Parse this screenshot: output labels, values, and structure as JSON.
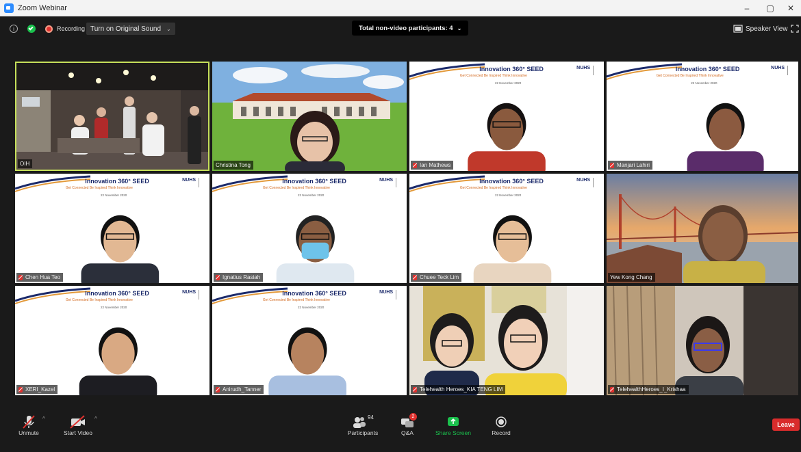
{
  "window": {
    "title": "Zoom Webinar",
    "minimize": "–",
    "maximize": "▢",
    "close": "✕"
  },
  "topbar": {
    "recording_label": "Recording",
    "original_sound_label": "Turn on Original Sound",
    "participants_banner": "Total non-video participants: 4",
    "speaker_view_label": "Speaker View"
  },
  "tiles": [
    {
      "name": "OIH",
      "kind": "office"
    },
    {
      "name": "Christina Tong",
      "kind": "building"
    },
    {
      "name": "Ian Mathews",
      "kind": "slide"
    },
    {
      "name": "Manjari Lahiri",
      "kind": "slide"
    },
    {
      "name": "Chen Hua Teo",
      "kind": "slide"
    },
    {
      "name": "Ignatius Rasiah",
      "kind": "slide"
    },
    {
      "name": "Chuee Teck Lim",
      "kind": "slide"
    },
    {
      "name": "Yew Kong Chang",
      "kind": "bridge"
    },
    {
      "name": "XERI_Kazel",
      "kind": "slide"
    },
    {
      "name": "Anirudh_Tanner",
      "kind": "slide"
    },
    {
      "name": "Telehealth Heroes_KIA TENG LIM",
      "kind": "home"
    },
    {
      "name": "TelehealthHeroes_I_Krishaa",
      "kind": "room"
    }
  ],
  "slide": {
    "title": "Innovation 360° SEED",
    "subtitle": "Get Connected Be Inspired Think Innovative",
    "date": "22 November 2020",
    "logo": "NUHS"
  },
  "bottombar": {
    "unmute": "Unmute",
    "start_video": "Start Video",
    "participants": "Participants",
    "participants_count": "94",
    "qa": "Q&A",
    "qa_badge": "2",
    "share_screen": "Share Screen",
    "record": "Record",
    "leave": "Leave"
  },
  "colors": {
    "active_speaker_border": "#c6e05a",
    "share_green": "#1bc14d",
    "leave_red": "#d92c2c",
    "badge_red": "#e0322f"
  }
}
